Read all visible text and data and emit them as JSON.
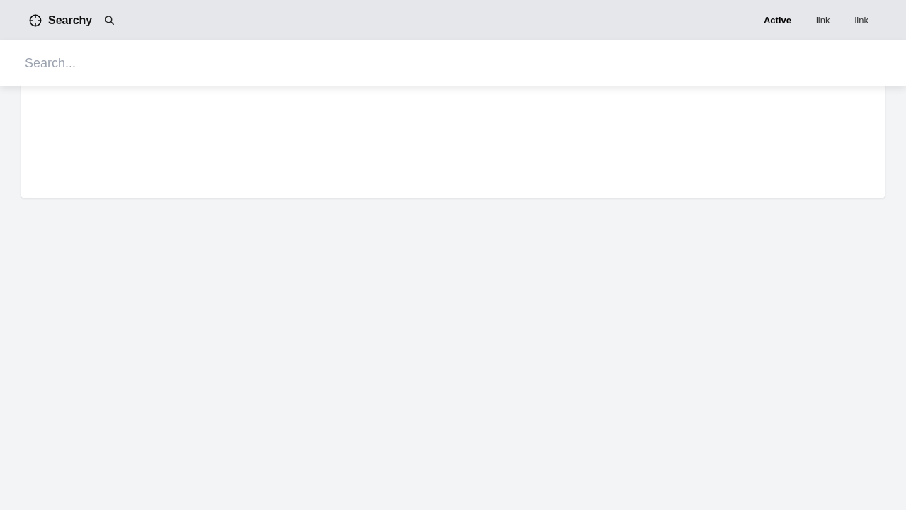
{
  "navbar": {
    "brand": "Searchy",
    "links": [
      {
        "label": "Active",
        "selected": true
      },
      {
        "label": "link",
        "selected": false
      },
      {
        "label": "link",
        "selected": false
      }
    ]
  },
  "search": {
    "placeholder": "Search..."
  }
}
